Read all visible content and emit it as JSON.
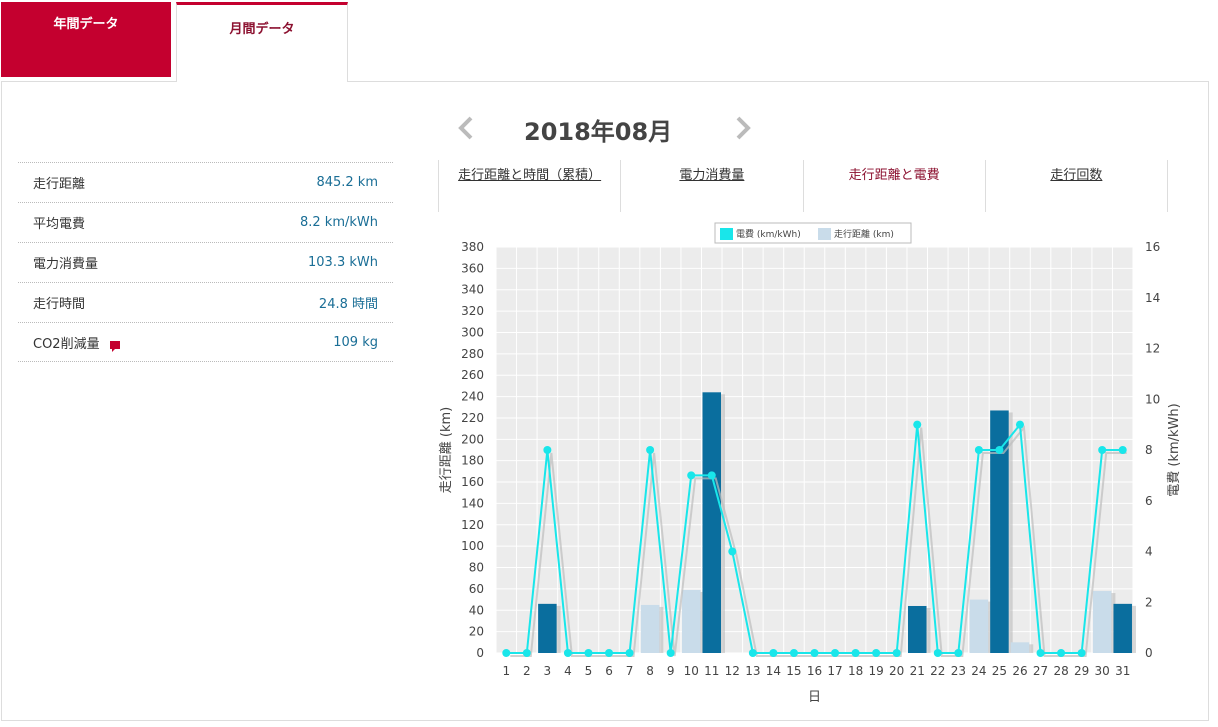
{
  "tabs": {
    "year_label": "年間データ",
    "month_label": "月間データ"
  },
  "header": {
    "month": "2018年08月",
    "prev_icon": "chevron-left-icon",
    "next_icon": "chevron-right-icon"
  },
  "summary": [
    {
      "label": "走行距離",
      "value": "845.2 km"
    },
    {
      "label": "平均電費",
      "value": "8.2 km/kWh"
    },
    {
      "label": "電力消費量",
      "value": "103.3 kWh"
    },
    {
      "label": "走行時間",
      "value": "24.8 時間"
    },
    {
      "label": "CO2削減量",
      "value": "109 kg"
    }
  ],
  "subtabs": [
    "走行距離と時間（累積）",
    "電力消費量",
    "走行距離と電費",
    "走行回数"
  ],
  "colors": {
    "brand": "#c4002f",
    "bar_dark": "#0a6e9e",
    "bar_light": "#c9dcea",
    "line": "#19e6ea"
  },
  "chart_data": {
    "type": "bar",
    "legend": [
      "電費 (km/kWh)",
      "走行距離 (km)"
    ],
    "xlabel": "日",
    "ylabel": "走行距離 (km)",
    "y2label": "電費 (km/kWh)",
    "ylim": [
      0,
      380
    ],
    "y2lim": [
      0,
      16
    ],
    "categories": [
      "1",
      "2",
      "3",
      "4",
      "5",
      "6",
      "7",
      "8",
      "9",
      "10",
      "11",
      "12",
      "13",
      "14",
      "15",
      "16",
      "17",
      "18",
      "19",
      "20",
      "21",
      "22",
      "23",
      "24",
      "25",
      "26",
      "27",
      "28",
      "29",
      "30",
      "31"
    ],
    "series": [
      {
        "name": "走行距離 (km)",
        "type": "bar",
        "values": [
          0,
          0,
          46,
          0,
          0,
          0,
          0,
          45,
          0,
          59,
          244,
          0,
          0,
          0,
          0,
          0,
          0,
          0,
          0,
          0,
          44,
          0,
          0,
          50,
          227,
          10,
          0,
          0,
          0,
          58,
          46
        ]
      },
      {
        "name": "電費 (km/kWh)",
        "type": "line",
        "values": [
          0,
          0,
          8,
          0,
          0,
          0,
          0,
          8,
          0,
          7,
          7,
          4,
          0,
          0,
          0,
          0,
          0,
          0,
          0,
          0,
          9,
          0,
          0,
          8,
          8,
          9,
          0,
          0,
          0,
          8,
          8
        ]
      }
    ],
    "bar_shade": [
      "dark",
      "dark",
      "dark",
      "dark",
      "dark",
      "dark",
      "dark",
      "light",
      "dark",
      "light",
      "dark",
      "dark",
      "dark",
      "dark",
      "dark",
      "dark",
      "dark",
      "dark",
      "dark",
      "dark",
      "dark",
      "dark",
      "dark",
      "light",
      "dark",
      "light",
      "dark",
      "dark",
      "dark",
      "light",
      "dark"
    ],
    "y_ticks": [
      0,
      20,
      40,
      60,
      80,
      100,
      120,
      140,
      160,
      180,
      200,
      220,
      240,
      260,
      280,
      300,
      320,
      340,
      360,
      380
    ],
    "y2_ticks": [
      0,
      2,
      4,
      6,
      8,
      10,
      12,
      14,
      16
    ],
    "grid": true,
    "legend_position": "top-center"
  }
}
